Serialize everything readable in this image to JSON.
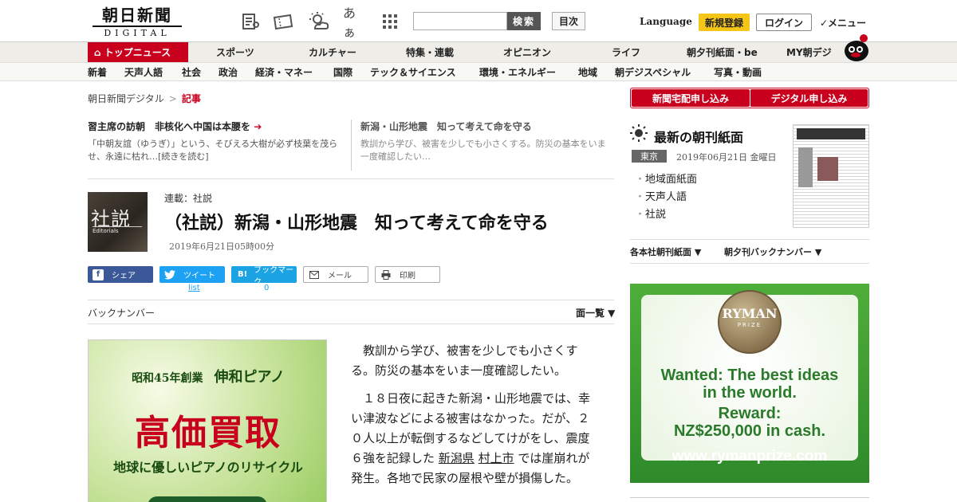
{
  "header": {
    "logo_ja": "朝日新聞",
    "logo_en": "DIGITAL",
    "search_placeholder": "",
    "search_button": "検索",
    "toc_button": "目次",
    "language": "Language",
    "signup": "新規登録",
    "login": "ログイン",
    "menu": "✓メニュー",
    "font_toggle": "あぁ"
  },
  "nav_main": [
    "トップニュース",
    "スポーツ",
    "カルチャー",
    "特集・連載",
    "オピニオン",
    "ライフ",
    "朝夕刊紙面・be",
    "MY朝デジ"
  ],
  "nav_sub": [
    "新着",
    "天声人語",
    "社会",
    "政治",
    "経済・マネー",
    "国際",
    "テック＆サイエンス",
    "環境・エネルギー",
    "地域",
    "朝デジスペシャル",
    "写真・動画"
  ],
  "breadcrumb": {
    "home": "朝日新聞デジタル",
    "sep": ">",
    "current": "記事"
  },
  "related": [
    {
      "title": "習主席の訪朝　非核化へ中国は本腰を",
      "desc": "「中朝友誼（ゆうぎ）」という、そびえる大樹が必ず枝葉を茂らせ、永遠に枯れ…[続きを読む]"
    },
    {
      "title": "新潟・山形地震　知って考えて命を守る",
      "desc": "教訓から学び、被害を少しでも小さくする。防災の基本をいま一度確認したい…"
    }
  ],
  "article": {
    "editorial_label_ja": "社説",
    "editorial_label_en": "Editorials",
    "series": "連載：社説",
    "title": "（社説）新潟・山形地震　知って考えて命を守る",
    "date": "2019年6月21日05時00分",
    "paragraph1": "教訓から学び、被害を少しでも小さくする。防災の基本をいま一度確認したい。",
    "paragraph2_a": "１８日夜に起きた新潟・山形地震では、幸い津波などによる被害はなかった。だが、２０人以上が転倒するなどしてけがをし、震度６強を記録した",
    "link1": "新潟県",
    "link2": "村上市",
    "paragraph2_b": "では崖崩れが発生。各地で民家の屋根や壁が損傷した。"
  },
  "share": {
    "facebook": "シェア",
    "twitter": "ツイート",
    "twitter_count": "list",
    "hatena": "ブックマーク",
    "hatena_icon": "B!",
    "hatena_count": "0",
    "mail": "メール",
    "print": "印刷"
  },
  "backnumber": {
    "label": "バックナンバー",
    "list": "面一覧 ▼"
  },
  "piano_ad": {
    "sub_prefix": "昭和45年創業",
    "sub_name": "伸和ピアノ",
    "main": "高価買取",
    "tagline": "地球に優しいピアノのリサイクル"
  },
  "sidebar": {
    "btn_home": "新聞宅配申し込み",
    "btn_digital": "デジタル申し込み",
    "morning_title": "最新の朝刊紙面",
    "region": "東京",
    "paper_date": "2019年06月21日 金曜日",
    "links": [
      "地域面紙面",
      "天声人語",
      "社説"
    ],
    "kakusha": "各本社朝刊紙面 ▼",
    "yukan_bn": "朝夕刊バックナンバー ▼"
  },
  "ryman_ad": {
    "medal": "RYMAN",
    "medal_sub": "PRIZE",
    "line1a": "Wanted: The best ideas",
    "line1b": "in the world.",
    "line2a": "Reward:",
    "line2b": "NZ$250,000 in cash.",
    "url": "www.rymanprize.com"
  },
  "colors": {
    "accent": "#c8001e",
    "signup": "#f5c518",
    "facebook": "#3b5998",
    "twitter": "#1da1f2"
  }
}
